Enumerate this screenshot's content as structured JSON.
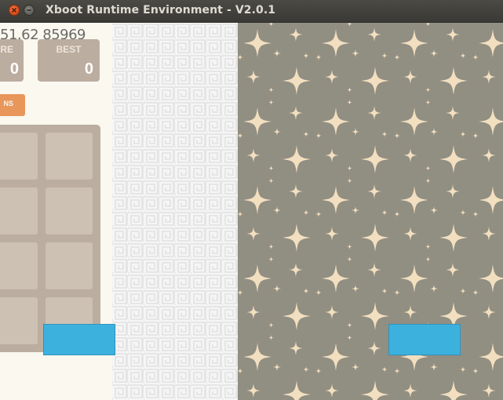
{
  "window": {
    "title": "Xboot Runtime Environment - V2.0.1"
  },
  "game": {
    "timer_text": "51.62 85969",
    "score": {
      "label": "RE",
      "value": "0"
    },
    "best": {
      "label": "BEST",
      "value": "0"
    },
    "new_game_label": "NS"
  },
  "colors": {
    "titlebar": "#3c3b37",
    "game_background": "#faf8ef",
    "tile_board": "#bbada0",
    "empty_cell": "#cdc1b4",
    "button_orange": "#e8965a",
    "stars_background": "#918e82",
    "star": "#f2dfc0",
    "blue_button": "#3db1de"
  }
}
